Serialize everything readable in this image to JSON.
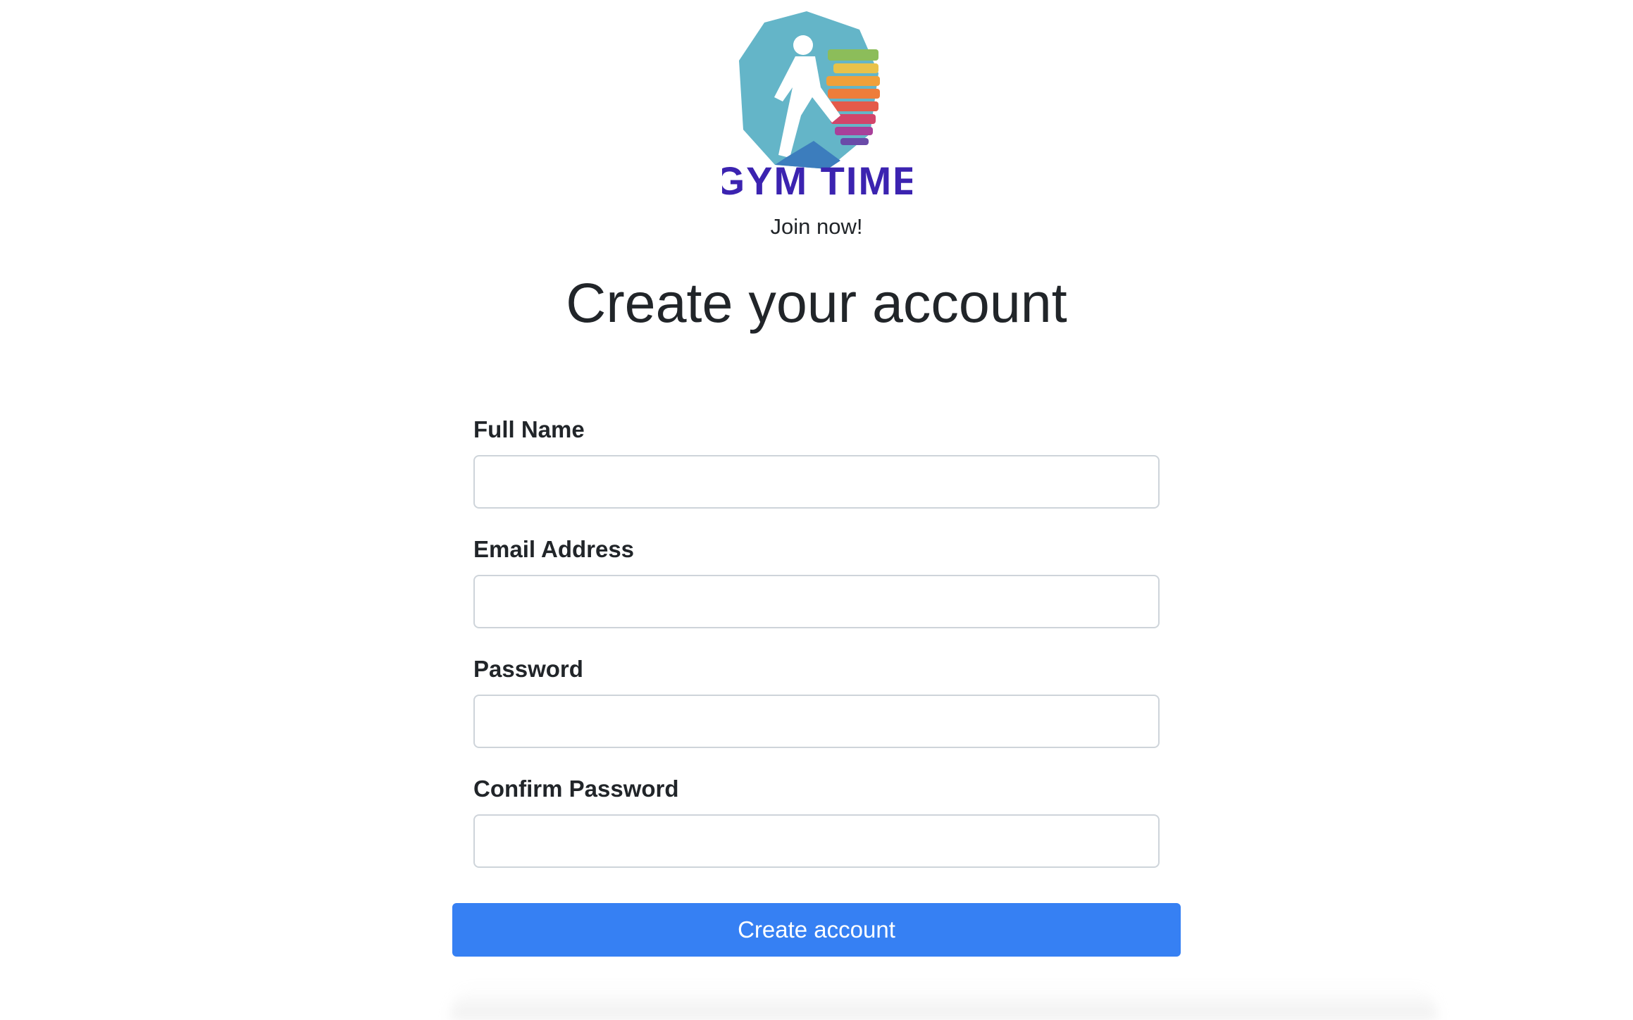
{
  "brand": {
    "name": "GYM TIME",
    "tagline": "Join now!"
  },
  "page": {
    "title": "Create your account"
  },
  "form": {
    "fields": [
      {
        "label": "Full Name",
        "value": "",
        "placeholder": ""
      },
      {
        "label": "Email Address",
        "value": "",
        "placeholder": ""
      },
      {
        "label": "Password",
        "value": "",
        "placeholder": ""
      },
      {
        "label": "Confirm Password",
        "value": "",
        "placeholder": ""
      }
    ],
    "submit_label": "Create account"
  },
  "colors": {
    "accent": "#3680f3",
    "brand_text": "#3b23b0",
    "hexagon": "#64b5c8",
    "text": "#212529",
    "input_border": "#ced4da"
  }
}
